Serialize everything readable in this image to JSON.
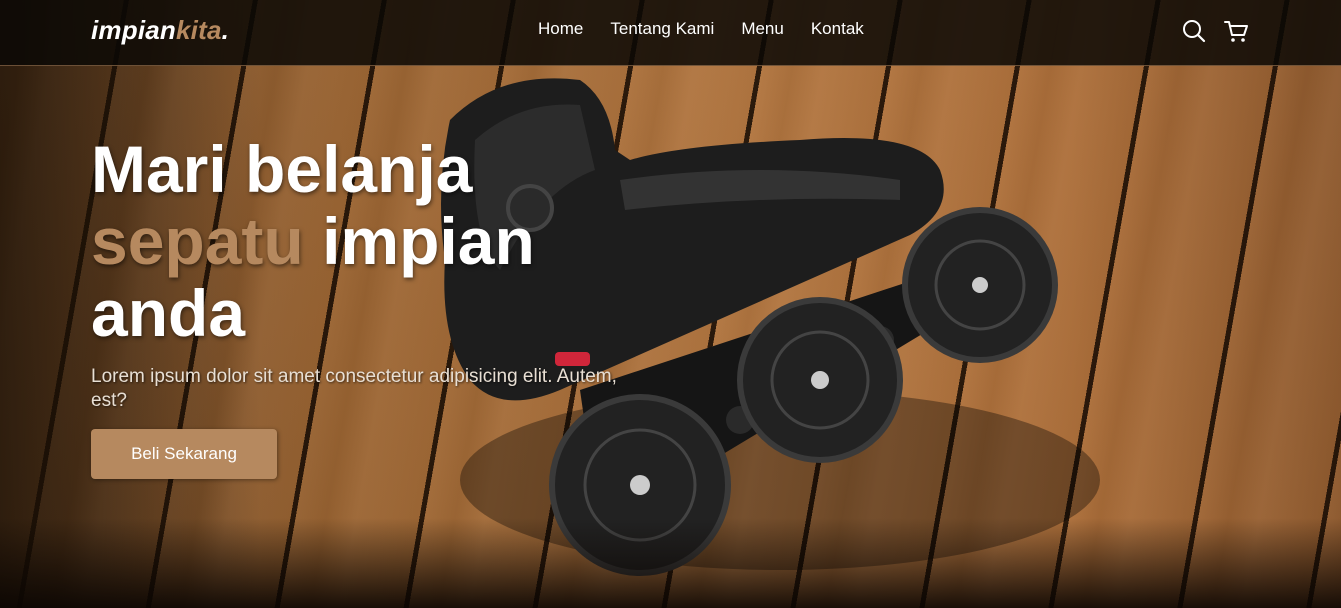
{
  "brand": {
    "name_main": "impian",
    "name_accent": "kita",
    "name_dot": ".",
    "accent_color": "#b6895f"
  },
  "nav": {
    "links": [
      {
        "label": "Home"
      },
      {
        "label": "Tentang Kami"
      },
      {
        "label": "Menu"
      },
      {
        "label": "Kontak"
      }
    ],
    "icons": [
      "search-icon",
      "shopping-cart-icon"
    ]
  },
  "hero": {
    "title_line1": "Mari belanja",
    "title_accent": "sepatu",
    "title_line2_rest": " impian",
    "title_line3": "anda",
    "description": "Lorem ipsum dolor sit amet consectetur adipisicing elit. Autem, est?",
    "cta_label": "Beli Sekarang",
    "background_image": "inline-skate-on-wooden-deck"
  }
}
